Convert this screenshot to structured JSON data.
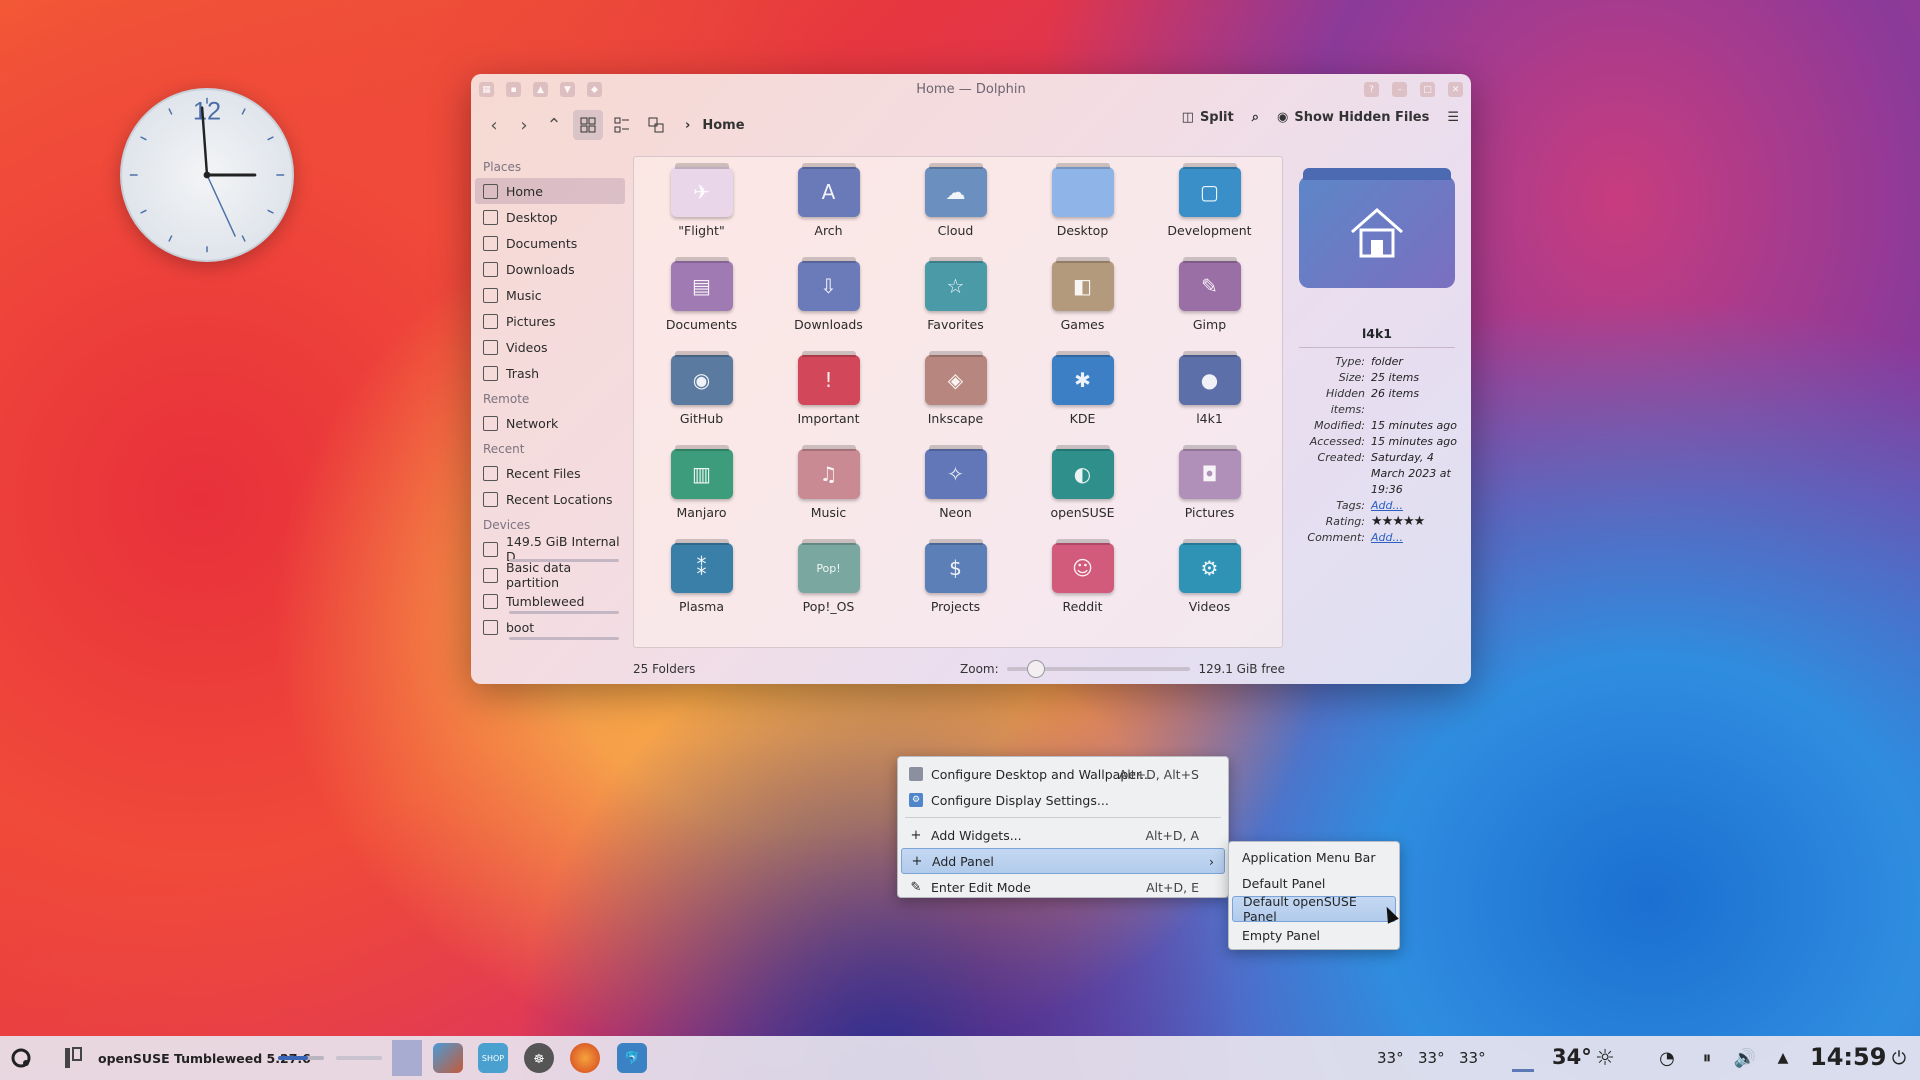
{
  "window": {
    "title": "Home — Dolphin",
    "breadcrumb": "Home",
    "actions": {
      "split": "Split",
      "hidden": "Show Hidden Files"
    }
  },
  "sidebar": {
    "places_head": "Places",
    "places": [
      "Home",
      "Desktop",
      "Documents",
      "Downloads",
      "Music",
      "Pictures",
      "Videos",
      "Trash"
    ],
    "remote_head": "Remote",
    "remote": [
      "Network"
    ],
    "recent_head": "Recent",
    "recent": [
      "Recent Files",
      "Recent Locations"
    ],
    "devices_head": "Devices",
    "devices": [
      "149.5 GiB Internal D...",
      "Basic data partition",
      "Tumbleweed",
      "boot"
    ]
  },
  "folders": [
    {
      "name": "\"Flight\"",
      "color": "#e9d6e8",
      "glyph": "✈"
    },
    {
      "name": "Arch",
      "color": "#6a79b8",
      "glyph": "A"
    },
    {
      "name": "Cloud",
      "color": "#6b8fbe",
      "glyph": "☁"
    },
    {
      "name": "Desktop",
      "color": "#8fb5e8",
      "glyph": ""
    },
    {
      "name": "Development",
      "color": "#3a8fc9",
      "glyph": "▢"
    },
    {
      "name": "Documents",
      "color": "#a07ab2",
      "glyph": "▤"
    },
    {
      "name": "Downloads",
      "color": "#6b7ab9",
      "glyph": "⇩"
    },
    {
      "name": "Favorites",
      "color": "#4b9aa8",
      "glyph": "☆"
    },
    {
      "name": "Games",
      "color": "#b49a7c",
      "glyph": "◧"
    },
    {
      "name": "Gimp",
      "color": "#9a6fa6",
      "glyph": "✎"
    },
    {
      "name": "GitHub",
      "color": "#5a7aa0",
      "glyph": "◉"
    },
    {
      "name": "Important",
      "color": "#d2475a",
      "glyph": "!"
    },
    {
      "name": "Inkscape",
      "color": "#b7867e",
      "glyph": "◈"
    },
    {
      "name": "KDE",
      "color": "#3d7fc4",
      "glyph": "✱"
    },
    {
      "name": "l4k1",
      "color": "#5c6fa8",
      "glyph": "●"
    },
    {
      "name": "Manjaro",
      "color": "#3c9c7c",
      "glyph": "▥"
    },
    {
      "name": "Music",
      "color": "#c98a94",
      "glyph": "♫"
    },
    {
      "name": "Neon",
      "color": "#6277b8",
      "glyph": "✧"
    },
    {
      "name": "openSUSE",
      "color": "#2e8f8b",
      "glyph": "◐"
    },
    {
      "name": "Pictures",
      "color": "#b090b8",
      "glyph": "◘"
    },
    {
      "name": "Plasma",
      "color": "#3a7fa8",
      "glyph": "⁑"
    },
    {
      "name": "Pop!_OS",
      "color": "#7aa7a0",
      "glyph": "Pop!"
    },
    {
      "name": "Projects",
      "color": "#5b7fb6",
      "glyph": "$"
    },
    {
      "name": "Reddit",
      "color": "#d25a7a",
      "glyph": "☺"
    },
    {
      "name": "Videos",
      "color": "#2f93b6",
      "glyph": "⚙"
    }
  ],
  "status": {
    "count": "25 Folders",
    "zoom_label": "Zoom:",
    "free": "129.1 GiB free",
    "zoom_level": 0.2
  },
  "info": {
    "name": "l4k1",
    "rows": [
      {
        "k": "Type:",
        "v": "folder"
      },
      {
        "k": "Size:",
        "v": "25 items"
      },
      {
        "k": "Hidden items:",
        "v": "26 items"
      },
      {
        "k": "Modified:",
        "v": "15 minutes ago"
      },
      {
        "k": "Accessed:",
        "v": "15 minutes ago"
      },
      {
        "k": "Created:",
        "v": "Saturday, 4 March 2023 at 19:36"
      }
    ],
    "tags_label": "Tags:",
    "tags_value": "Add...",
    "rating_label": "Rating:",
    "rating": 5,
    "comment_label": "Comment:",
    "comment_value": "Add..."
  },
  "menu": {
    "configure_desktop": "Configure Desktop and Wallpaper...",
    "configure_desktop_sc": "Alt+D, Alt+S",
    "configure_display": "Configure Display Settings...",
    "add_widgets": "Add Widgets...",
    "add_widgets_sc": "Alt+D, A",
    "add_panel": "Add Panel",
    "edit_mode": "Enter Edit Mode",
    "edit_mode_sc": "Alt+D, E"
  },
  "submenu": [
    "Application Menu Bar",
    "Default Panel",
    "Default openSUSE Panel",
    "Empty Panel"
  ],
  "taskbar": {
    "task_label": "openSUSE Tumbleweed 5.27.6",
    "temps": [
      "33°",
      "33°",
      "33°"
    ],
    "weather": "34°",
    "time": "14:59"
  },
  "clock": {
    "numeral": "12"
  }
}
